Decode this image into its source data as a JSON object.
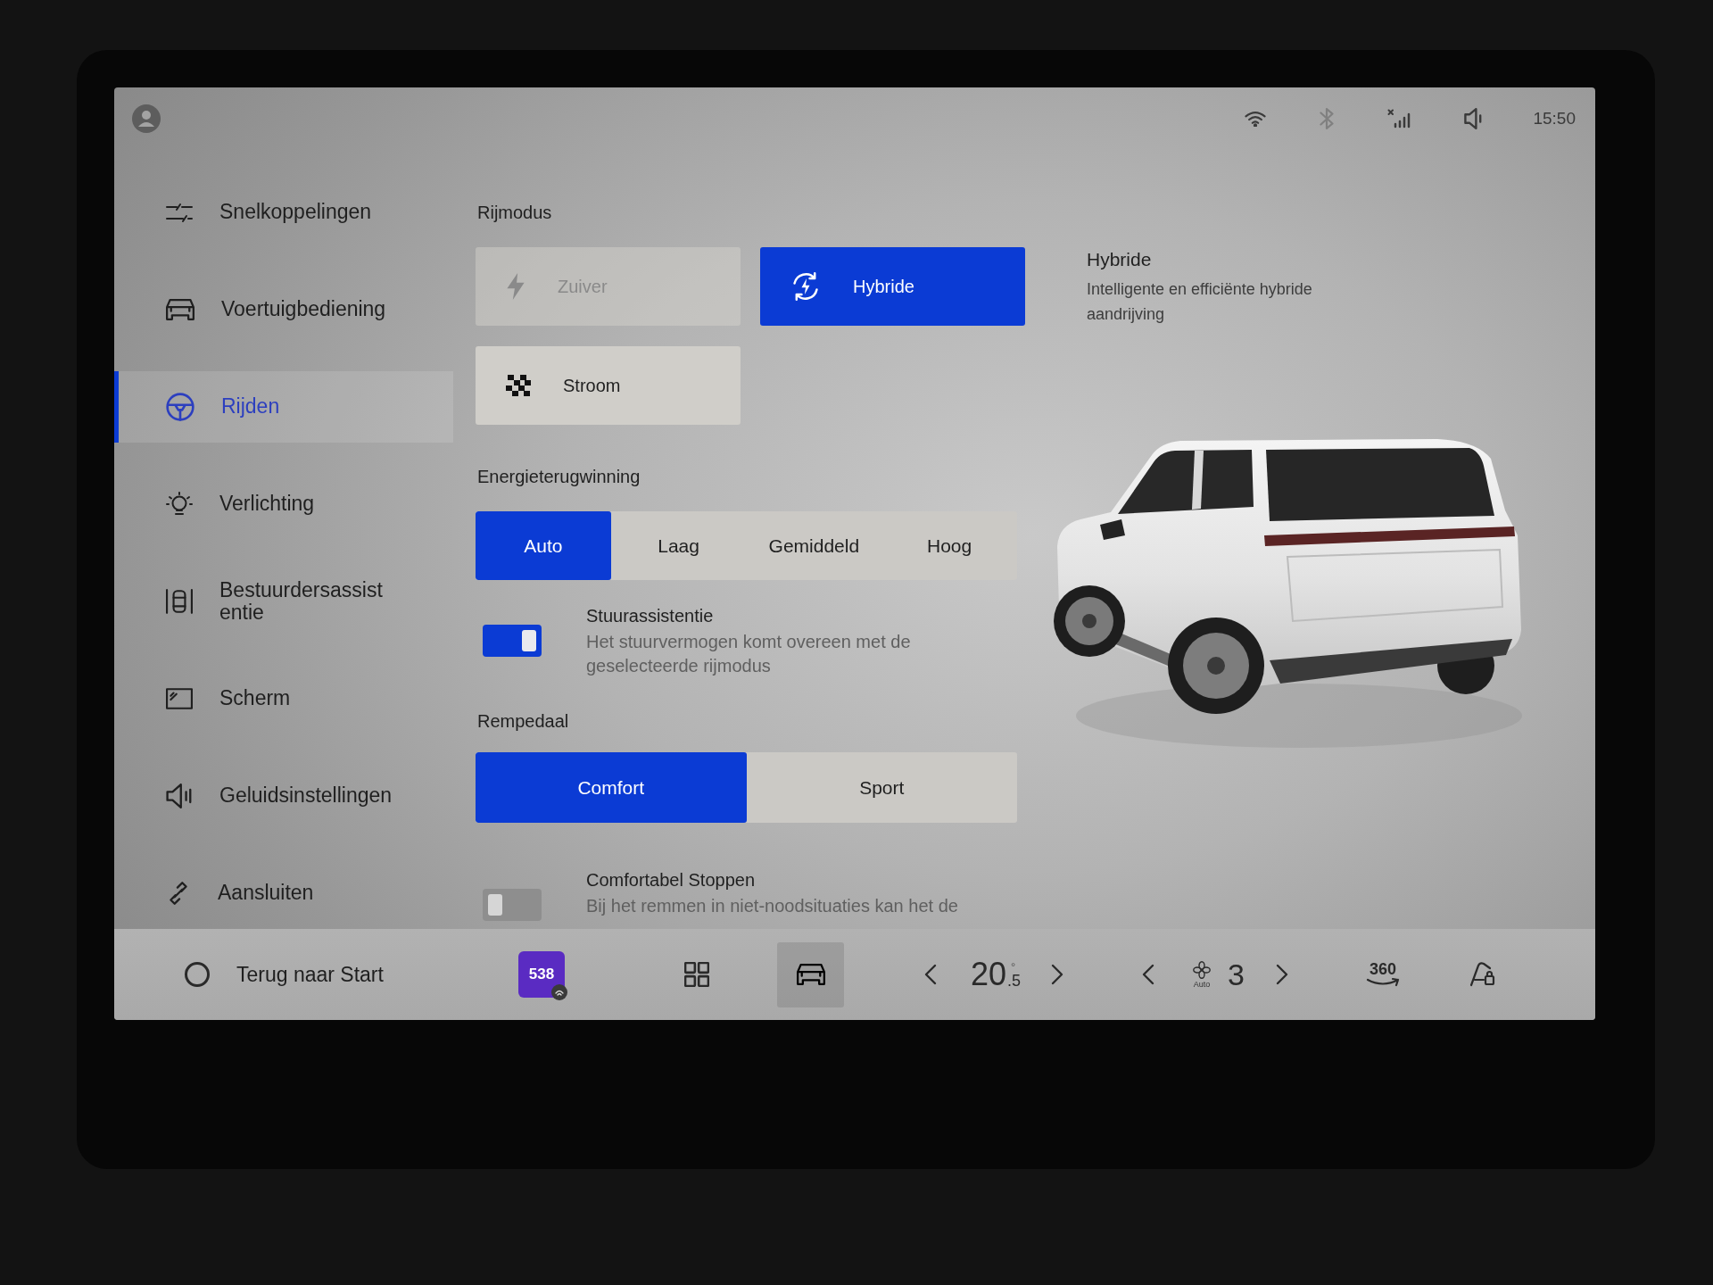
{
  "status_bar": {
    "icons": [
      {
        "kind": "wifi",
        "dimmed": false
      },
      {
        "kind": "bluetooth",
        "dimmed": true
      },
      {
        "kind": "signal",
        "dimmed": false
      },
      {
        "kind": "volume",
        "dimmed": false
      }
    ],
    "time": "15:50"
  },
  "sidebar": {
    "items": [
      {
        "label": "Snelkoppelingen",
        "selected": false
      },
      {
        "label": "Voertuigbediening",
        "selected": false
      },
      {
        "label": "Rijden",
        "selected": true
      },
      {
        "label": "Verlichting",
        "selected": false
      },
      {
        "label": "Bestuurdersassistentie",
        "selected": false
      },
      {
        "label": "Scherm",
        "selected": false
      },
      {
        "label": "Geluidsinstellingen",
        "selected": false
      },
      {
        "label": "Aansluiten",
        "selected": false
      }
    ]
  },
  "drive_mode": {
    "heading": "Rijmodus",
    "options": [
      {
        "label": "Zuiver",
        "selected": false,
        "disabled": true
      },
      {
        "label": "Hybride",
        "selected": true,
        "disabled": false
      },
      {
        "label": "Stroom",
        "selected": false,
        "disabled": false
      }
    ],
    "info": {
      "title": "Hybride",
      "text": "Intelligente en efficiënte hybride aandrijving"
    }
  },
  "energy_recovery": {
    "heading": "Energieterugwinning",
    "options": [
      {
        "label": "Auto",
        "selected": true
      },
      {
        "label": "Laag",
        "selected": false
      },
      {
        "label": "Gemiddeld",
        "selected": false
      },
      {
        "label": "Hoog",
        "selected": false
      }
    ]
  },
  "steering_assist": {
    "title": "Stuurassistentie",
    "description": "Het stuurvermogen komt overeen met de geselecteerde rijmodus",
    "on": true
  },
  "brake_pedal": {
    "heading": "Rempedaal",
    "options": [
      {
        "label": "Comfort",
        "selected": true
      },
      {
        "label": "Sport",
        "selected": false
      }
    ]
  },
  "comfort_stop": {
    "title": "Comfortabel Stoppen",
    "description": "Bij het remmen in niet-noodsituaties kan het de",
    "on": false
  },
  "bottom_bar": {
    "home": {
      "label": "Terug naar Start"
    },
    "dock": [
      {
        "kind": "radio",
        "label": "538",
        "selected": false
      },
      {
        "kind": "grid",
        "selected": false
      },
      {
        "kind": "vehicle",
        "selected": true
      }
    ],
    "climate": {
      "temperature": "20",
      "decimal": ".5",
      "unit": "°"
    },
    "fan": {
      "mode": "Auto",
      "speed": "3"
    },
    "camera": {
      "label": "360"
    }
  }
}
